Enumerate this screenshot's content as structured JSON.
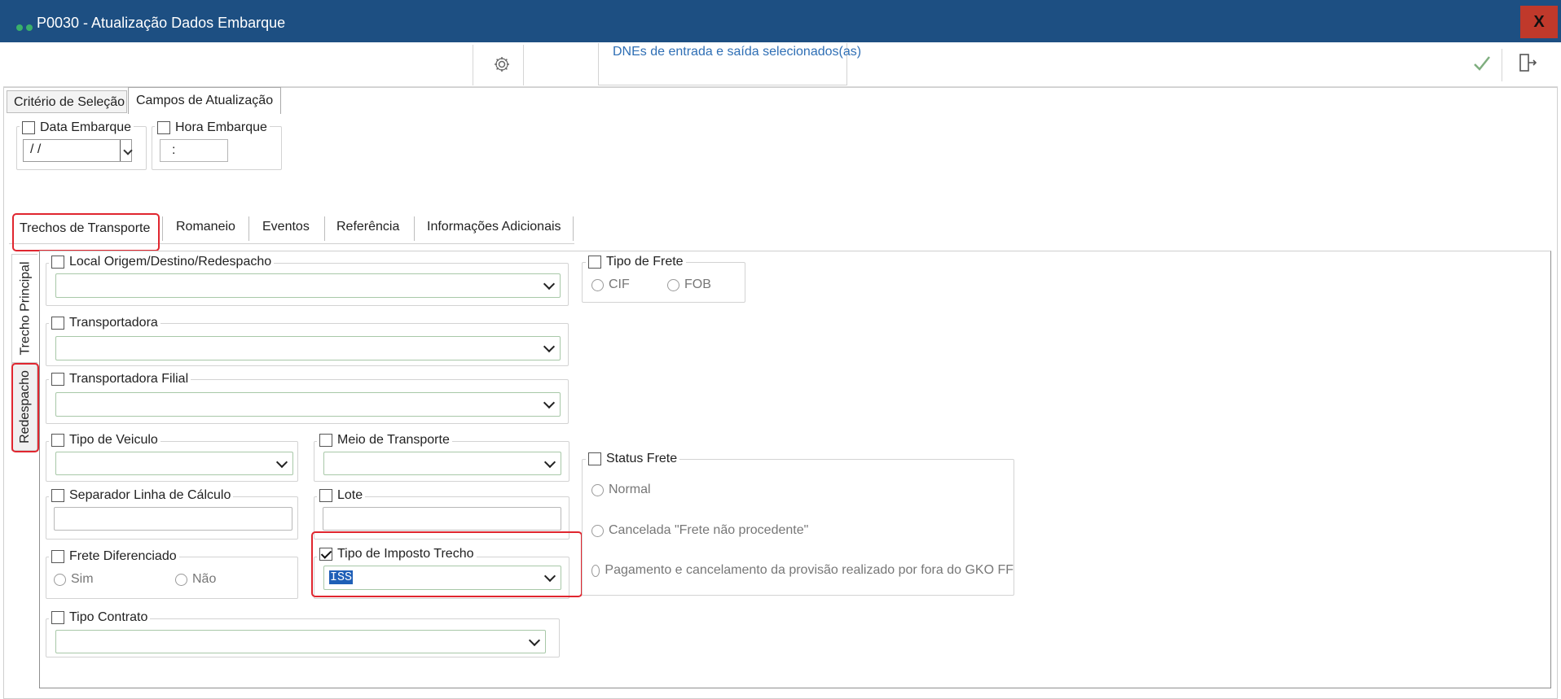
{
  "window": {
    "title": "P0030 - Atualização Dados Embarque",
    "close_label": "X"
  },
  "toolbar": {
    "message": "DNEs de entrada e saída selecionados(as)"
  },
  "tabs": [
    {
      "label": "Critério de Seleção"
    },
    {
      "label": "Campos de Atualização"
    }
  ],
  "top_fields": {
    "data_embarque": {
      "label": "Data Embarque",
      "value": " / /"
    },
    "hora_embarque": {
      "label": "Hora Embarque",
      "value": ":"
    }
  },
  "subtabs": [
    {
      "label": "Trechos de Transporte"
    },
    {
      "label": "Romaneio"
    },
    {
      "label": "Eventos"
    },
    {
      "label": "Referência"
    },
    {
      "label": "Informações Adicionais"
    }
  ],
  "vertical_tabs": [
    {
      "label": "Trecho Principal"
    },
    {
      "label": "Redespacho"
    }
  ],
  "fields": {
    "local": {
      "label": "Local Origem/Destino/Redespacho",
      "checked": false
    },
    "transportadora": {
      "label": "Transportadora",
      "checked": false
    },
    "transportadora_filial": {
      "label": "Transportadora Filial",
      "checked": false
    },
    "tipo_veiculo": {
      "label": "Tipo de Veiculo",
      "checked": false
    },
    "meio_transporte": {
      "label": "Meio de Transporte",
      "checked": false
    },
    "separador": {
      "label": "Separador Linha de Cálculo",
      "checked": false
    },
    "lote": {
      "label": "Lote",
      "checked": false
    },
    "frete_diferenciado": {
      "label": "Frete Diferenciado",
      "checked": false,
      "options": [
        "Sim",
        "Não"
      ]
    },
    "tipo_imposto": {
      "label": "Tipo de Imposto Trecho",
      "checked": true,
      "value": "ISS"
    },
    "tipo_contrato": {
      "label": "Tipo Contrato",
      "checked": false
    },
    "tipo_frete": {
      "label": "Tipo de Frete",
      "checked": false,
      "options": [
        "CIF",
        "FOB"
      ]
    },
    "status_frete": {
      "label": "Status Frete",
      "checked": false,
      "options": [
        "Normal",
        "Cancelada \"Frete não procedente\"",
        "Pagamento e cancelamento da provisão realizado por fora do GKO FF"
      ]
    }
  },
  "colors": {
    "titlebar": "#1d4f82",
    "close": "#c0392b",
    "accent_link": "#2f6fb5",
    "highlight_box": "#e0262f",
    "selection": "#1f5fb7"
  },
  "icons": [
    "settings-gear-icon",
    "confirm-check-icon",
    "exit-door-icon",
    "close-icon"
  ]
}
